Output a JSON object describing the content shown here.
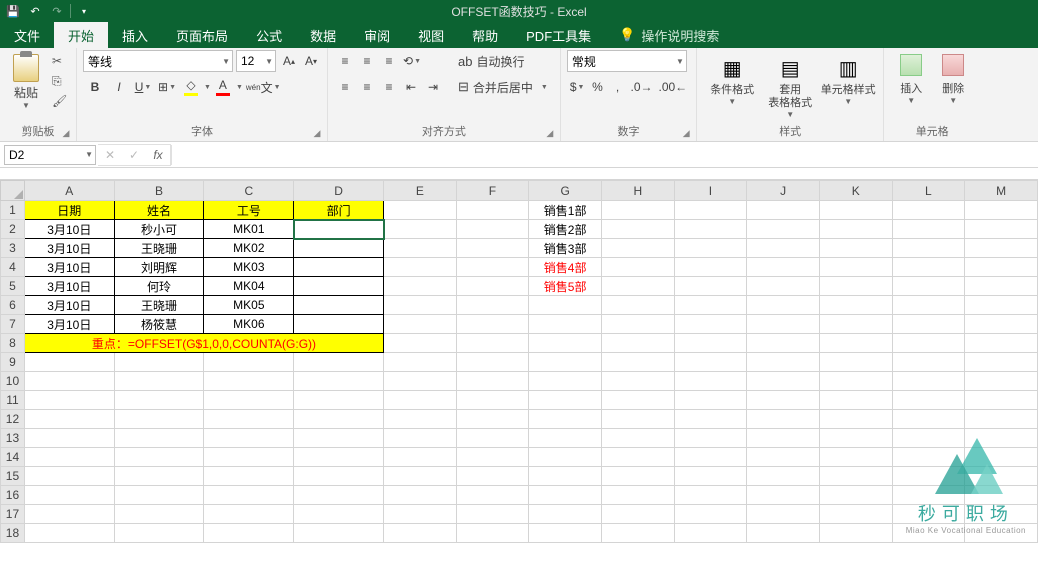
{
  "title": "OFFSET函数技巧  -  Excel",
  "tabs": {
    "file": "文件",
    "home": "开始",
    "insert": "插入",
    "layout": "页面布局",
    "formula": "公式",
    "data": "数据",
    "review": "审阅",
    "view": "视图",
    "help": "帮助",
    "pdf": "PDF工具集",
    "tell": "操作说明搜索"
  },
  "ribbon": {
    "clipboard": {
      "paste": "粘贴",
      "group": "剪贴板"
    },
    "font": {
      "name": "等线",
      "size": "12",
      "group": "字体"
    },
    "align": {
      "wrap": "自动换行",
      "merge": "合并后居中",
      "group": "对齐方式"
    },
    "number": {
      "format": "常规",
      "group": "数字"
    },
    "styles": {
      "cond": "条件格式",
      "table": "套用\n表格格式",
      "cell": "单元格样式",
      "group": "样式"
    },
    "cells": {
      "insert": "插入",
      "delete": "删除",
      "group": "单元格"
    }
  },
  "namebox": "D2",
  "columns": [
    "A",
    "B",
    "C",
    "D",
    "E",
    "F",
    "G",
    "H",
    "I",
    "J",
    "K",
    "L",
    "M"
  ],
  "headers": {
    "A": "日期",
    "B": "姓名",
    "C": "工号",
    "D": "部门"
  },
  "rows": [
    {
      "A": "3月10日",
      "B": "秒小可",
      "C": "MK01"
    },
    {
      "A": "3月10日",
      "B": "王晓珊",
      "C": "MK02"
    },
    {
      "A": "3月10日",
      "B": "刘明辉",
      "C": "MK03"
    },
    {
      "A": "3月10日",
      "B": "何玲",
      "C": "MK04"
    },
    {
      "A": "3月10日",
      "B": "王晓珊",
      "C": "MK05"
    },
    {
      "A": "3月10日",
      "B": "杨筱慧",
      "C": "MK06"
    }
  ],
  "formula_note": "重点：=OFFSET(G$1,0,0,COUNTA(G:G))",
  "gcol": [
    {
      "t": "销售1部",
      "red": false
    },
    {
      "t": "销售2部",
      "red": false
    },
    {
      "t": "销售3部",
      "red": false
    },
    {
      "t": "销售4部",
      "red": true
    },
    {
      "t": "销售5部",
      "red": true
    }
  ],
  "watermark": {
    "cn": "秒可职场",
    "en": "Miao Ke Vocational Education"
  }
}
